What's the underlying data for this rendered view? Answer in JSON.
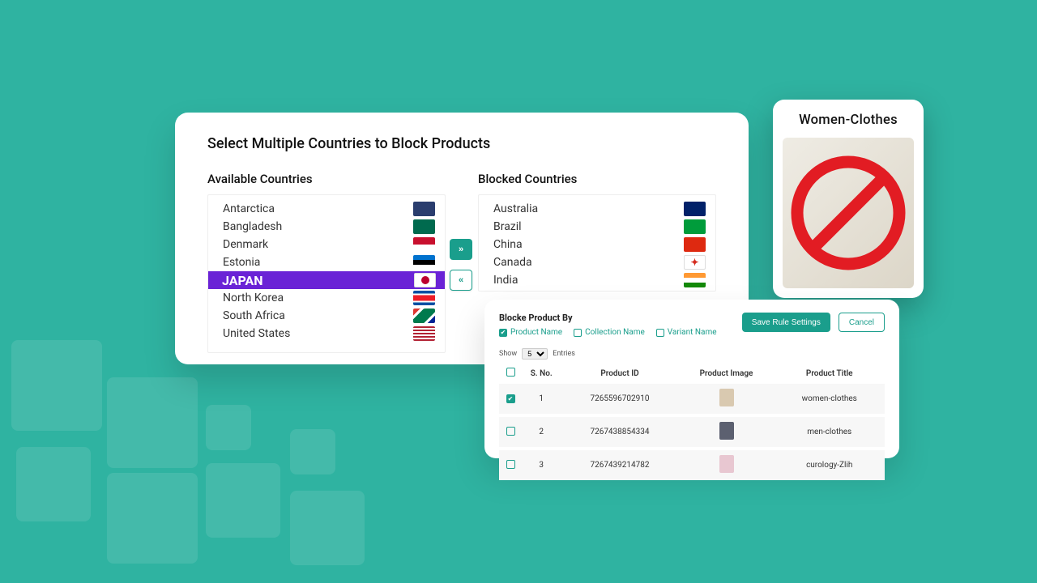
{
  "colors": {
    "accent": "#2fb3a1",
    "selected": "#6a23d6",
    "forbid": "#e21c23"
  },
  "countries": {
    "title": "Select Multiple Countries to Block Products",
    "available_label": "Available Countries",
    "blocked_label": "Blocked Countries",
    "buttons": {
      "move_right": "»",
      "move_left": "«"
    },
    "available": [
      {
        "name": "Antarctica",
        "flag_bg": "#2a3d6e"
      },
      {
        "name": "Bangladesh",
        "flag_bg": "#006a4e"
      },
      {
        "name": "Denmark",
        "flag_bg": "#c8102e"
      },
      {
        "name": "Estonia",
        "flag_bg": "#0072ce"
      },
      {
        "name": "JAPAN",
        "flag_bg": "#ffffff",
        "selected": true
      },
      {
        "name": "North Korea",
        "flag_bg": "#024fa2"
      },
      {
        "name": "South Africa",
        "flag_bg": "#007a4d"
      },
      {
        "name": "United States",
        "flag_bg": "#3c3b6e"
      }
    ],
    "blocked": [
      {
        "name": "Australia",
        "flag_bg": "#012169"
      },
      {
        "name": "Brazil",
        "flag_bg": "#009c3b"
      },
      {
        "name": "China",
        "flag_bg": "#de2910"
      },
      {
        "name": "Canada",
        "flag_bg": "#ffffff"
      },
      {
        "name": "India",
        "flag_bg": "#ff9933"
      }
    ]
  },
  "product_card": {
    "title": "Women-Clothes"
  },
  "rule": {
    "title": "Blocke Product By",
    "filters": [
      {
        "label": "Product Name",
        "checked": true
      },
      {
        "label": "Collection Name",
        "checked": false
      },
      {
        "label": "Variant Name",
        "checked": false
      }
    ],
    "save_label": "Save Rule Settings",
    "cancel_label": "Cancel",
    "show_label": "Show",
    "show_value": "5",
    "entries_label": "Entries",
    "headers": {
      "chk": "",
      "sno": "S. No.",
      "pid": "Product ID",
      "pimg": "Product Image",
      "ptitle": "Product Title"
    },
    "rows": [
      {
        "checked": true,
        "sno": "1",
        "pid": "7265596702910",
        "title": "women-clothes",
        "thumb": "#d9c9b0"
      },
      {
        "checked": false,
        "sno": "2",
        "pid": "7267438854334",
        "title": "men-clothes",
        "thumb": "#5c6070"
      },
      {
        "checked": false,
        "sno": "3",
        "pid": "7267439214782",
        "title": "curology-Zlih",
        "thumb": "#e8c7d1"
      }
    ]
  }
}
